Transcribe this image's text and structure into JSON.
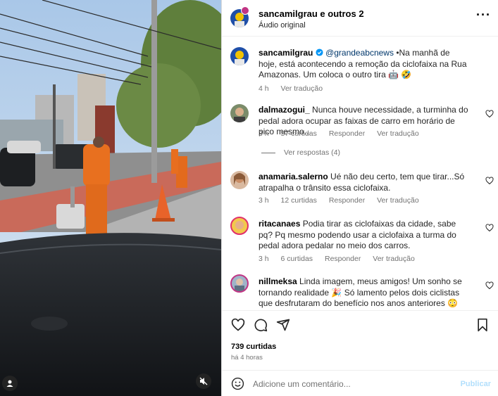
{
  "post": {
    "author": "sancamilgrau e outros 2",
    "audio": "Áudio original",
    "more_icon": "ellipsis-icon"
  },
  "caption": {
    "username": "sancamilgrau",
    "mention": "@grandeabcnews",
    "text": " •Na manhã de hoje, está acontecendo a remoção da ciclofaixa na Rua Amazonas. Um coloca o outro tira 🤖 🤣",
    "time": "4 h",
    "translate": "Ver tradução"
  },
  "comments": [
    {
      "username": "dalmazogui_",
      "text": " Nunca houve necessidade, a turminha do pedal adora ocupar as faixas de carro em horário de pico mesmo...",
      "time": "3 h",
      "likes": "57 curtidas",
      "reply": "Responder",
      "translate": "Ver tradução",
      "view_replies": "Ver respostas (4)"
    },
    {
      "username": "anamaria.salerno",
      "text": " Ué não deu certo, tem que tirar...Só atrapalha o trânsito essa ciclofaixa.",
      "time": "3 h",
      "likes": "12 curtidas",
      "reply": "Responder",
      "translate": "Ver tradução"
    },
    {
      "username": "ritacanaes",
      "text": " Podia tirar as ciclofaixas da cidade, sabe pq? Pq mesmo podendo usar a ciclofaixa a turma do pedal adora pedalar no meio dos carros.",
      "time": "3 h",
      "likes": "6 curtidas",
      "reply": "Responder",
      "translate": "Ver tradução"
    },
    {
      "username": "nillmeksa",
      "text": " Linda imagem, meus amigos! Um sonho se tornando realidade 🎉 Só lamento pelos dois ciclistas que desfrutaram do benefício nos anos anteriores 😳"
    }
  ],
  "footer": {
    "likes": "739 curtidas",
    "time": "há 4 horas",
    "comment_placeholder": "Adicione um comentário...",
    "publish": "Publicar"
  },
  "colors": {
    "link": "#00376b",
    "muted": "#737373",
    "verified": "#0095f6",
    "publish_disabled": "#b2dffc"
  }
}
